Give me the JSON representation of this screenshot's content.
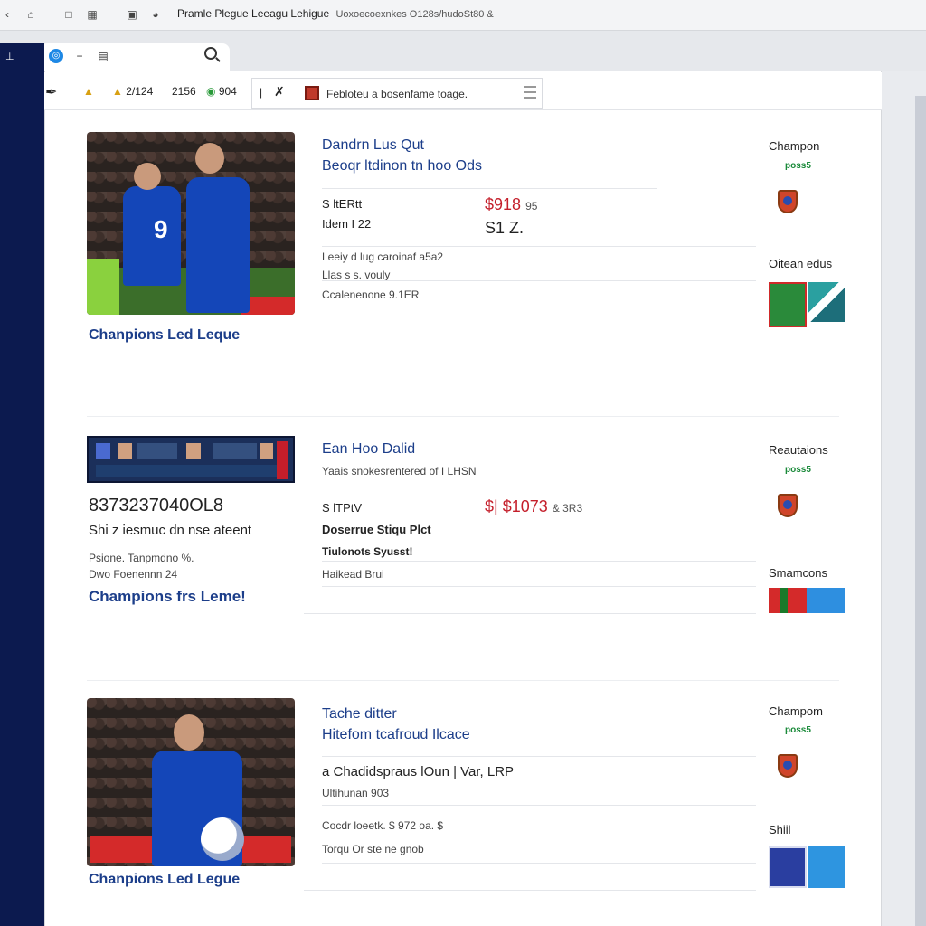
{
  "browser": {
    "title": "Pramle Plegue Leeagu Lehigue",
    "url": "Uoxoecoexnkes O128s/hudoSt80 &"
  },
  "toolbar": {
    "stat1": "2/124",
    "stat2": "2156",
    "stat3": "904",
    "filter_text": "Febloteu a bosenfame toage."
  },
  "cards": [
    {
      "title": "Chanpions Led Leque",
      "headline1": "Dandrn Lus Qut",
      "headline2": "Beoqr ltdinon tn hoo Ods",
      "stat_label1": "S ltERtt",
      "stat_label2": "Idem I 22",
      "stat_red": "$918",
      "stat_red_suffix": "95",
      "stat_big": "S1 Z.",
      "line1": "Leeiy d lug caroinaf a5a2",
      "line2": "Llas s s. vouly",
      "line3": "Ccalenenone 9.1ER",
      "side1_head": "Champon",
      "side1_green": "poss5",
      "side2_head": "Oitean edus"
    },
    {
      "title": "Champions frs Leme!",
      "code": "8373237040OL8",
      "subtitle": "Shi z iesmuc dn nse ateent",
      "meta1": "Psione. Tanpmdno %.",
      "meta2": "Dwo Foenennn 24",
      "headline1": "Ean Hoo Dalid",
      "subline": "Yaais snokesrentered of I LHSN",
      "stat_label1": "S lTPtV",
      "stat_red": "$| $1073",
      "stat_red_suffix": "& 3R3",
      "bold1": "Doserrue Stiqu Plct",
      "bold2": "Tiulonots Syusst!",
      "line3": "Haikead Brui",
      "side1_head": "Reautaions",
      "side1_green": "poss5",
      "side2_head": "Smamcons"
    },
    {
      "title": "Chanpions Led Legue",
      "headline1": "Tache ditter",
      "headline2": "Hitefom tcafroud Ilcace",
      "bold_line": "a Chadidspraus lOun | Var, LRP",
      "line1": "Ultihunan 903",
      "line2": "Cocdr loeetk. $ 972 oa. $",
      "line3": "Torqu Or ste ne gnob",
      "side1_head": "Champom",
      "side1_green": "poss5",
      "side2_head": "Shiil"
    }
  ],
  "colors": {
    "nav": "#0c1a4f",
    "link": "#1c3e8a",
    "price": "#c41e2a",
    "green": "#1a8a3a"
  }
}
